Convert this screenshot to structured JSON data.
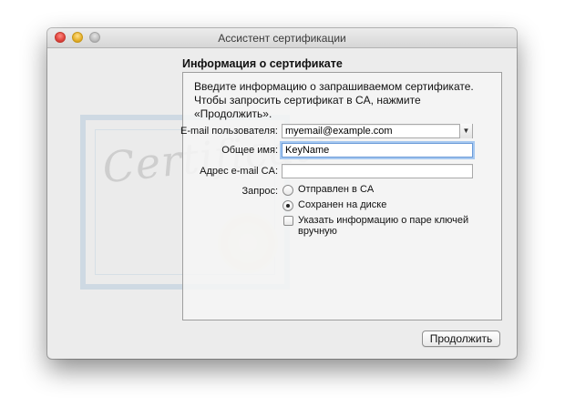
{
  "window": {
    "title": "Ассистент сертификации"
  },
  "artwork": {
    "script_text": "Certificate"
  },
  "section": {
    "title": "Информация о сертификате",
    "intro_line1": "Введите информацию о запрашиваемом сертификате.",
    "intro_line2": "Чтобы запросить сертификат в CA, нажмите",
    "intro_line3": "«Продолжить»."
  },
  "form": {
    "email_label": "E-mail пользователя:",
    "email_value": "myemail@example.com",
    "common_name_label": "Общее имя:",
    "common_name_value": "KeyName",
    "ca_email_label": "Адрес e-mail CA:",
    "ca_email_value": "",
    "request_label": "Запрос:",
    "options": [
      {
        "label": "Отправлен в CA",
        "checked": false
      },
      {
        "label": "Сохранен на диске",
        "checked": true
      }
    ],
    "manual_keypair_label": "Указать информацию о паре ключей вручную",
    "manual_keypair_checked": false
  },
  "buttons": {
    "continue_label": "Продолжить"
  },
  "icons": {
    "combo_arrow": "▼"
  }
}
